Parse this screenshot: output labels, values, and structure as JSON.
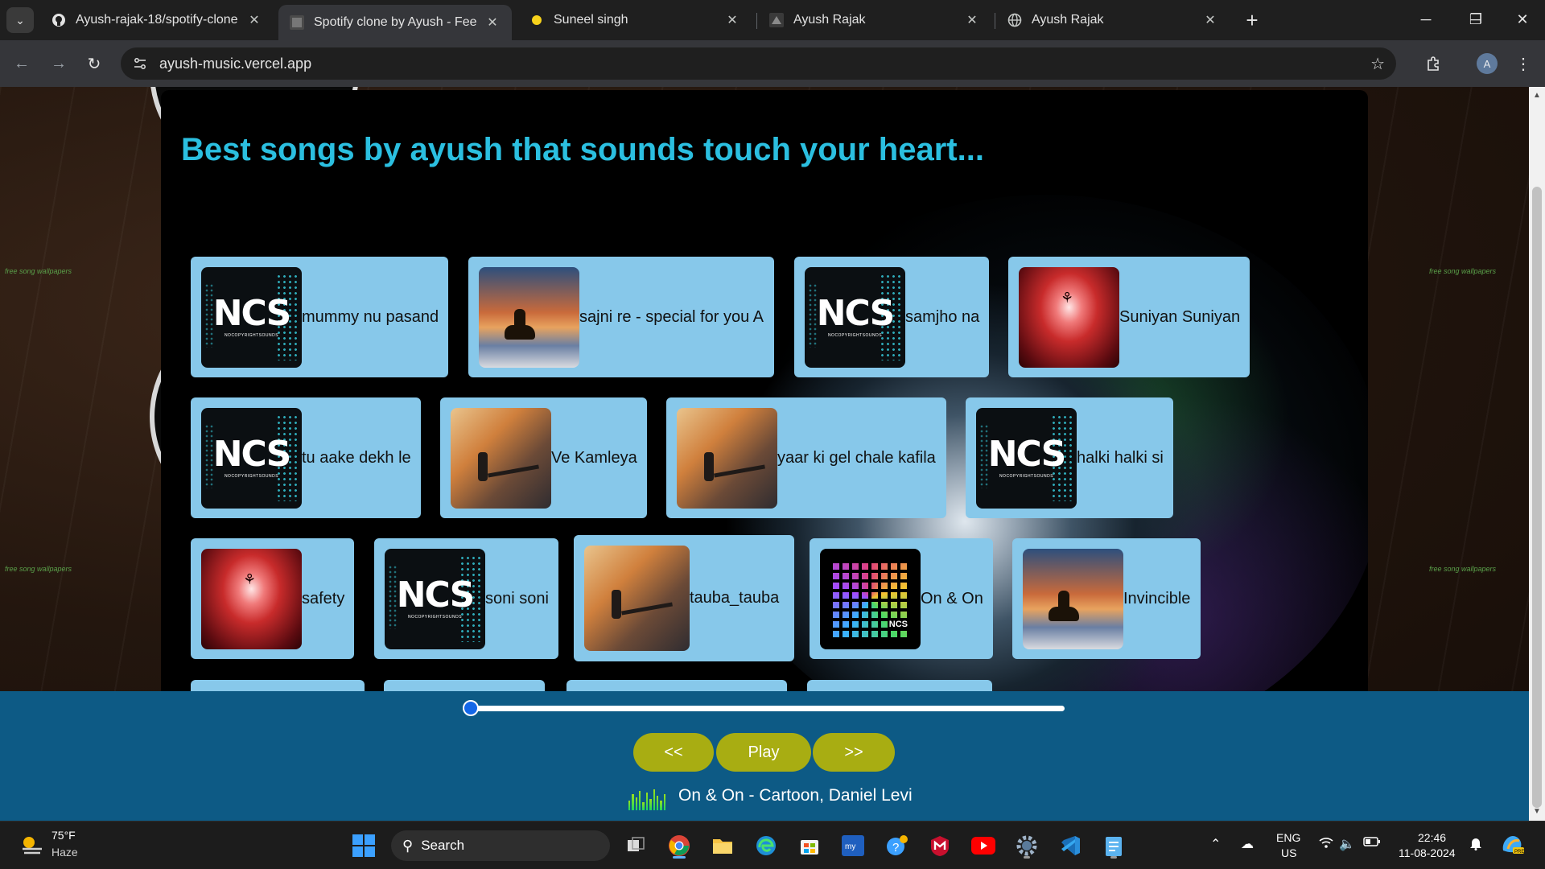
{
  "browser": {
    "tabs": [
      {
        "title": "Ayush-rajak-18/spotify-clone",
        "icon": "github-icon",
        "active": false
      },
      {
        "title": "Spotify clone by Ayush - Feel every beat",
        "icon": "site-thumbnail-icon",
        "active": true
      },
      {
        "title": "Suneel singh",
        "icon": "yellow-dot-icon",
        "active": false
      },
      {
        "title": "Ayush Rajak",
        "icon": "site-thumbnail-icon",
        "active": false
      },
      {
        "title": "Ayush Rajak",
        "icon": "globe-icon",
        "active": false
      }
    ],
    "url": "ayush-music.vercel.app",
    "profile_initial": "A"
  },
  "page": {
    "heading": "Best songs by ayush that sounds touch your heart...",
    "side_watermark": "free song wallpapers",
    "songs": [
      {
        "name": "mummy nu pasand",
        "cover": "ncs-logo"
      },
      {
        "name": "sajni re - special for you A",
        "cover": "desert-rider"
      },
      {
        "name": "samjho na",
        "cover": "ncs-logo"
      },
      {
        "name": "Suniyan Suniyan",
        "cover": "red-figure"
      },
      {
        "name": "tu aake dekh le",
        "cover": "ncs-logo"
      },
      {
        "name": "Ve Kamleya",
        "cover": "war-soldier"
      },
      {
        "name": "yaar ki gel chale kafila",
        "cover": "war-soldier"
      },
      {
        "name": "halki halki si",
        "cover": "ncs-logo"
      },
      {
        "name": "safety",
        "cover": "red-figure"
      },
      {
        "name": "soni soni",
        "cover": "ncs-logo"
      },
      {
        "name": "tauba_tauba",
        "cover": "war-soldier"
      },
      {
        "name": "On & On",
        "cover": "on-and-on"
      },
      {
        "name": "Invincible",
        "cover": "desert-rider"
      }
    ],
    "ncs_label": "NCS",
    "ncs_sub": "NOCOPYRIGHTSOUNDS",
    "ncs_tag": "NCS"
  },
  "player": {
    "progress_percent": 0,
    "prev_label": "<<",
    "play_label": "Play",
    "next_label": ">>",
    "now_playing": "On & On - Cartoon, Daniel Levi"
  },
  "taskbar": {
    "temperature": "75°F",
    "condition": "Haze",
    "search_placeholder": "Search",
    "language": "ENG",
    "region": "US",
    "time": "22:46",
    "date": "11-08-2024",
    "apps": [
      "file-explorer-icon",
      "chrome-icon",
      "folder-icon",
      "edge-icon",
      "store-icon",
      "mylio-icon",
      "help-icon",
      "mcafee-icon",
      "youtube-icon",
      "settings-icon",
      "vscode-icon",
      "notepad-icon"
    ]
  },
  "colors": {
    "heading": "#2bbfe0",
    "card_bg": "#87c8ea",
    "player_bg": "#0d5a85",
    "button_bg": "#a8ad12"
  }
}
